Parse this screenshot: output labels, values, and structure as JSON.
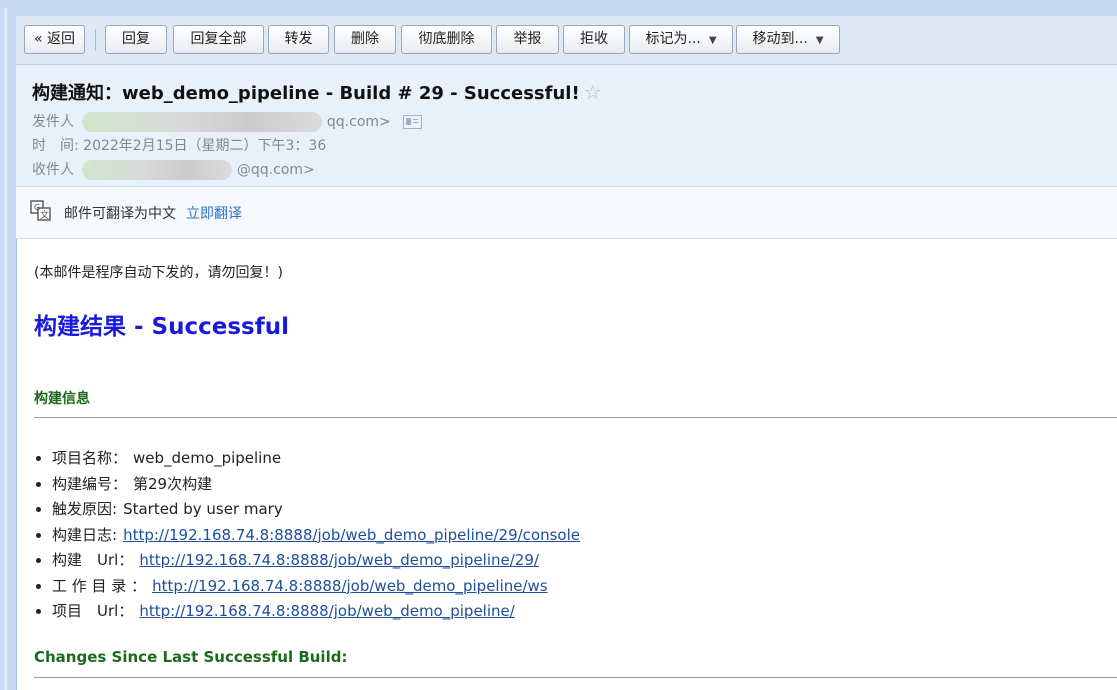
{
  "toolbar": {
    "buttons": {
      "back": "« 返回",
      "reply": "回复",
      "reply_all": "回复全部",
      "forward": "转发",
      "delete": "删除",
      "delete_forever": "彻底删除",
      "report": "举报",
      "reject": "拒收",
      "mark_as": "标记为...",
      "move_to": "移动到..."
    }
  },
  "email": {
    "subject": "构建通知：web_demo_pipeline - Build # 29 - Successful!",
    "star": "☆",
    "from_label": "发件人",
    "from_value": "qq.com>",
    "time_label": "时　间:",
    "time_value": "2022年2月15日（星期二）下午3：36",
    "to_label": "收件人",
    "to_value": "@qq.com>"
  },
  "translate": {
    "text": "邮件可翻译为中文",
    "link": "立即翻译"
  },
  "body": {
    "notice": "(本邮件是程序自动下发的，请勿回复！)",
    "result_title": "构建结果 - Successful",
    "build_info_title": "构建信息",
    "items": [
      {
        "label": "项目名称：",
        "value": "web_demo_pipeline"
      },
      {
        "label": "构建编号：",
        "value": "第29次构建"
      },
      {
        "label": "触发原因:",
        "value": "Started by user mary"
      },
      {
        "label": "构建日志:",
        "value": "http://192.168.74.8:8888/job/web_demo_pipeline/29/console"
      },
      {
        "label": "构建　Url：",
        "value": "http://192.168.74.8:8888/job/web_demo_pipeline/29/"
      },
      {
        "label": "工 作 目 录 ：",
        "value": "http://192.168.74.8:8888/job/web_demo_pipeline/ws"
      },
      {
        "label": "项目　Url：",
        "value": "http://192.168.74.8:8888/job/web_demo_pipeline/"
      }
    ],
    "changes_title": "Changes Since Last Successful Build:"
  }
}
